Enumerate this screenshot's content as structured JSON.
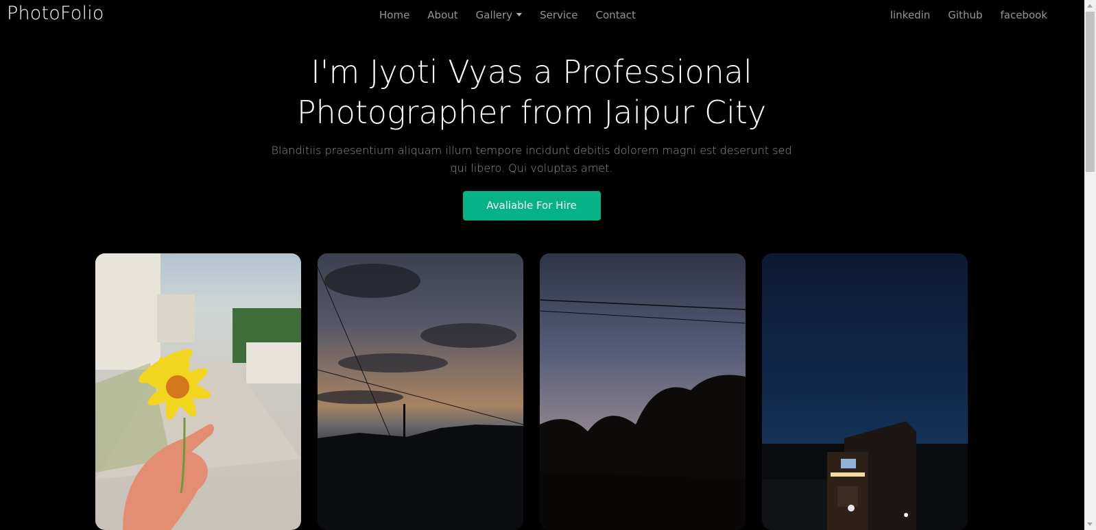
{
  "nav": {
    "brand": "PhotoFolio",
    "center": [
      "Home",
      "About",
      "Gallery",
      "Service",
      "Contact"
    ],
    "right": [
      "linkedin",
      "Github",
      "facebook"
    ]
  },
  "hero": {
    "title": "I'm Jyoti Vyas a Professional Photographer from Jaipur City",
    "subtitle": "Blanditiis praesentium aliquam illum tempore incidunt debitis dolorem magni est deserunt sed qui libero. Qui voluptas amet.",
    "cta": "Avaliable For Hire"
  },
  "colors": {
    "accent": "#05b386",
    "background": "#000000"
  },
  "gallery": [
    "flower-photo",
    "sunset-sky-photo",
    "dusk-trees-photo",
    "night-house-photo"
  ]
}
